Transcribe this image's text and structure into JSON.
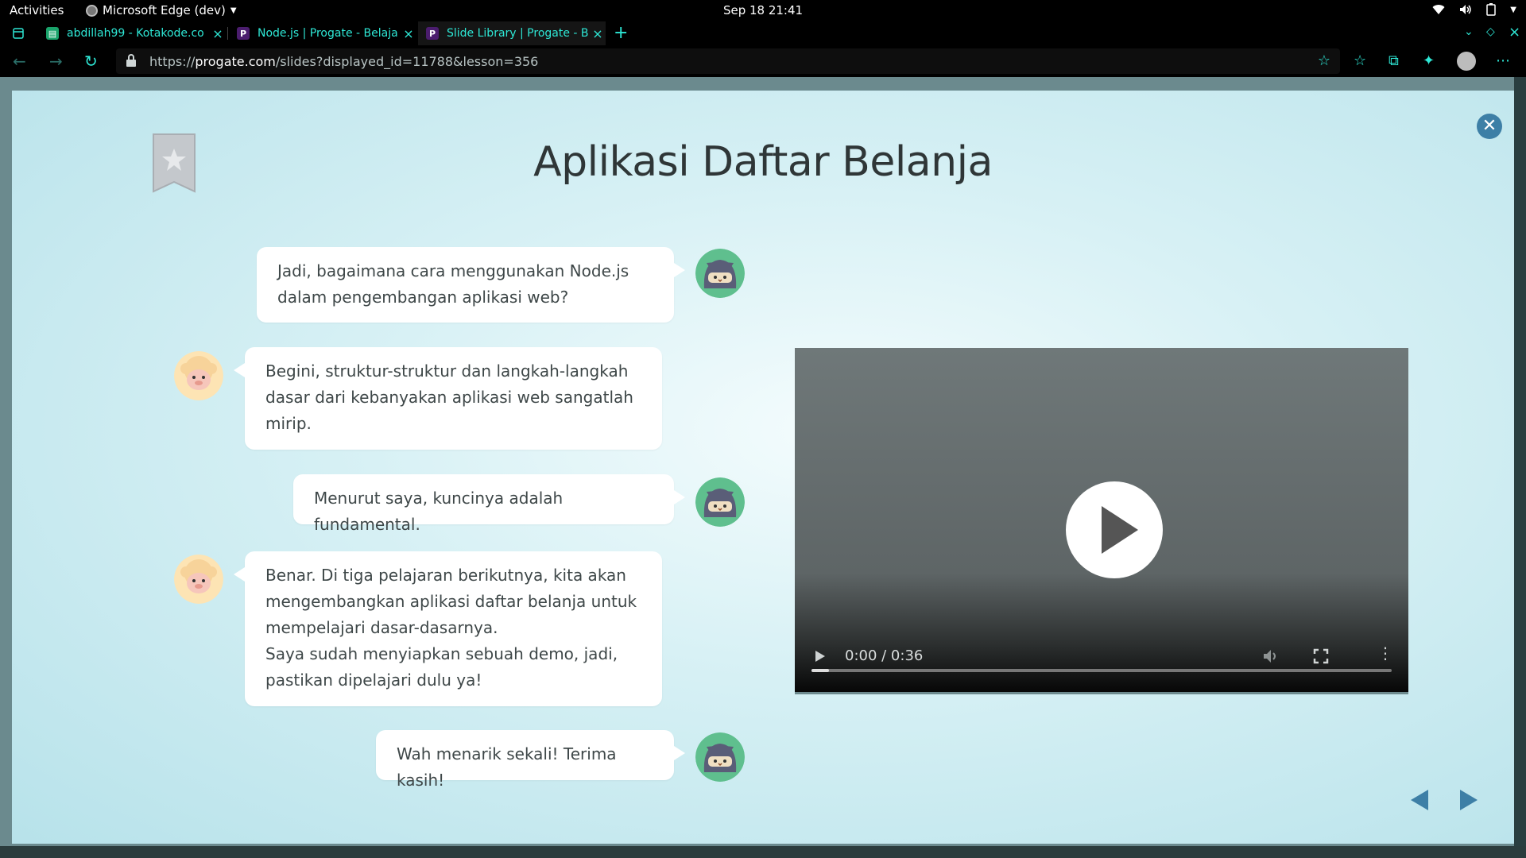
{
  "system": {
    "activities": "Activities",
    "app_name": "Microsoft Edge (dev)",
    "clock": "Sep 18  21:41"
  },
  "tabs": [
    {
      "title": "abdillah99 - Kotakode.co",
      "favicon_color": "#1aa36b"
    },
    {
      "title": "Node.js | Progate - Belaja",
      "favicon_color": "#4b1d6e"
    },
    {
      "title": "Slide Library | Progate - B",
      "favicon_color": "#4b1d6e"
    }
  ],
  "address": {
    "url_prefix": "https://",
    "url_domain": "progate.com",
    "url_path": "/slides?displayed_id=11788&lesson=356"
  },
  "slide": {
    "title": "Aplikasi Daftar Belanja",
    "messages": [
      {
        "speaker": "ninja",
        "side": "right",
        "text": "Jadi, bagaimana cara menggunakan Node.js\ndalam pengembangan aplikasi web?"
      },
      {
        "speaker": "sheep",
        "side": "left",
        "text": "Begini, struktur-struktur dan langkah-langkah\ndasar dari kebanyakan aplikasi web sangatlah\nmirip."
      },
      {
        "speaker": "ninja",
        "side": "right",
        "text": "Menurut saya, kuncinya adalah fundamental."
      },
      {
        "speaker": "sheep",
        "side": "left",
        "text": "Benar. Di tiga pelajaran berikutnya, kita akan\nmengembangkan aplikasi daftar belanja untuk\nmempelajari dasar-dasarnya.\nSaya sudah menyiapkan sebuah demo, jadi,\npastikan dipelajari dulu ya!"
      },
      {
        "speaker": "ninja",
        "side": "right",
        "text": "Wah menarik sekali! Terima kasih!"
      }
    ],
    "video": {
      "time": "0:00 / 0:36",
      "progress": 0.03
    }
  },
  "colors": {
    "accent": "#3d7fa6",
    "tab_text": "#2ee8d6"
  }
}
